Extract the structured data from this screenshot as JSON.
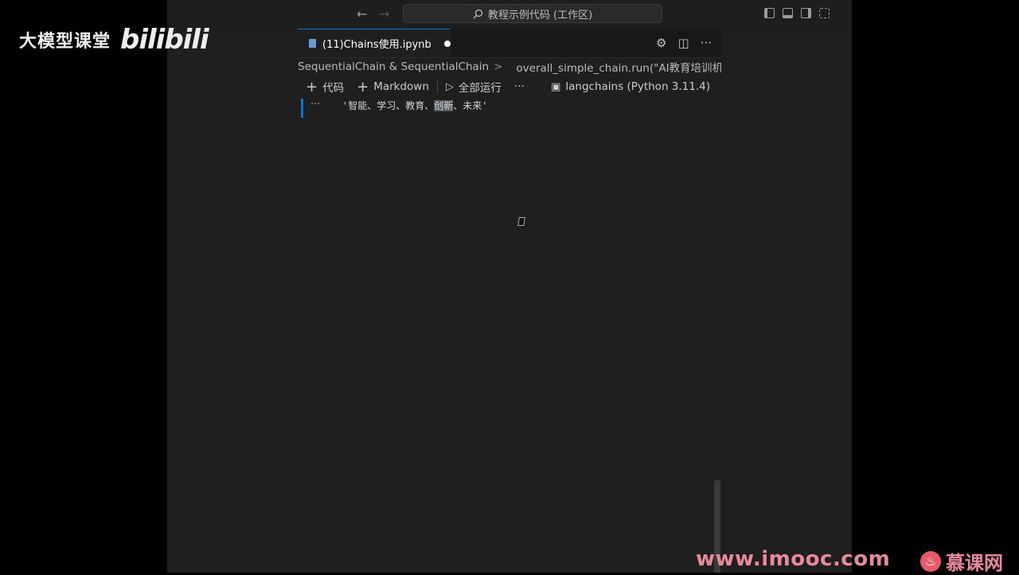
{
  "overlay": {
    "channel_text": "大模型课堂",
    "bilibili_logo": "bilibili",
    "imooc_url": "www.imooc.com",
    "imooc_name": "慕课网"
  },
  "titlebar": {
    "back_icon": "←",
    "forward_icon": "→",
    "search_text": "教程示例代码 (工作区)"
  },
  "tab": {
    "label": "(11)Chains使用.ipynb"
  },
  "breadcrumb": {
    "part1": "SequentialChain & SequentialChain",
    "separator": ">",
    "part2": "overall_simple_chain.run(\"AI教育培训机构\")"
  },
  "toolbar": {
    "add_code": "代码",
    "add_markdown": "Markdown",
    "run_all": "全部运行",
    "more": "···",
    "kernel": "langchains (Python 3.11.4)"
  },
  "output": {
    "dots": "···",
    "text_before": "'智能、学习、教育、",
    "text_highlight": "创新",
    "text_after": "、未来'"
  }
}
